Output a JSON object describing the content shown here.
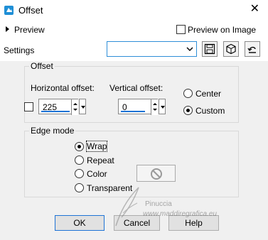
{
  "window": {
    "title": "Offset",
    "close_glyph": "✕"
  },
  "preview": {
    "label": "Preview",
    "preview_on_image_label": "Preview on Image",
    "preview_on_image_checked": false
  },
  "settings": {
    "label": "Settings",
    "combo_value": "",
    "icons": [
      "save-icon",
      "cube-icon",
      "reset-icon"
    ]
  },
  "offset_group": {
    "title": "Offset",
    "horizontal_label": "Horizontal offset:",
    "horizontal_value": "225",
    "vertical_label": "Vertical offset:",
    "vertical_value": "0",
    "linked_checked": false,
    "mode_options": [
      {
        "label": "Center",
        "selected": false
      },
      {
        "label": "Custom",
        "selected": true
      }
    ]
  },
  "edge_group": {
    "title": "Edge mode",
    "options": [
      {
        "label": "Wrap",
        "selected": true
      },
      {
        "label": "Repeat",
        "selected": false
      },
      {
        "label": "Color",
        "selected": false
      },
      {
        "label": "Transparent",
        "selected": false
      }
    ],
    "color_swatch_icon": "no-sign-icon"
  },
  "buttons": {
    "ok": "OK",
    "cancel": "Cancel",
    "help": "Help"
  },
  "watermark": {
    "name": "Pinuccia",
    "url": "www.maddiregrafica.eu"
  },
  "colors": {
    "accent": "#1e73d6",
    "panel": "#f0f0f0",
    "app_icon": "#1f8fd6"
  }
}
